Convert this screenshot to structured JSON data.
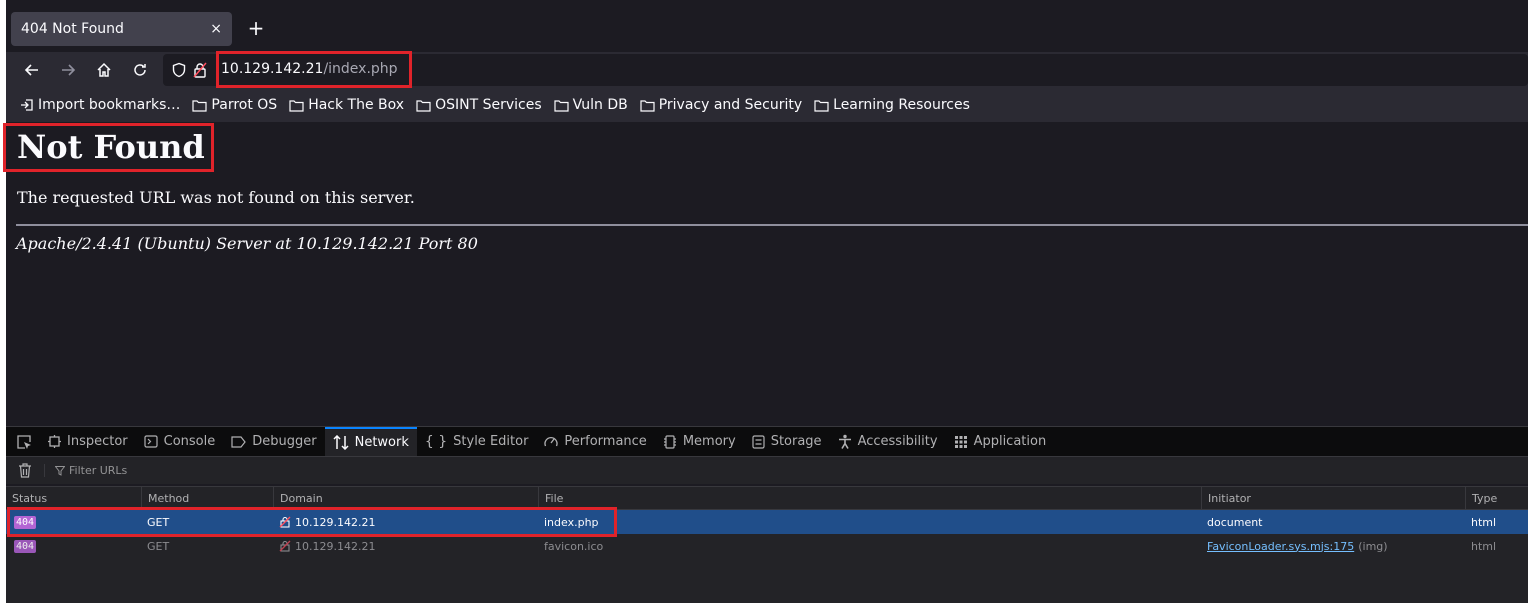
{
  "tab": {
    "title": "404 Not Found",
    "close": "×",
    "new_tab": "+"
  },
  "url": {
    "host": "10.129.142.21",
    "path": "/index.php"
  },
  "bookmarks": [
    {
      "label": "Import bookmarks…",
      "icon": "import-icon"
    },
    {
      "label": "Parrot OS",
      "icon": "folder-icon"
    },
    {
      "label": "Hack The Box",
      "icon": "folder-icon"
    },
    {
      "label": "OSINT Services",
      "icon": "folder-icon"
    },
    {
      "label": "Vuln DB",
      "icon": "folder-icon"
    },
    {
      "label": "Privacy and Security",
      "icon": "folder-icon"
    },
    {
      "label": "Learning Resources",
      "icon": "folder-icon"
    }
  ],
  "page": {
    "title": "Not Found",
    "message": "The requested URL was not found on this server.",
    "address": "Apache/2.4.41 (Ubuntu) Server at 10.129.142.21 Port 80"
  },
  "devtools": {
    "tabs": [
      {
        "label": "Inspector",
        "icon": "inspector-icon"
      },
      {
        "label": "Console",
        "icon": "console-icon"
      },
      {
        "label": "Debugger",
        "icon": "debugger-icon"
      },
      {
        "label": "Network",
        "icon": "network-icon",
        "active": true
      },
      {
        "label": "Style Editor",
        "icon": "style-editor-icon"
      },
      {
        "label": "Performance",
        "icon": "performance-icon"
      },
      {
        "label": "Memory",
        "icon": "memory-icon"
      },
      {
        "label": "Storage",
        "icon": "storage-icon"
      },
      {
        "label": "Accessibility",
        "icon": "accessibility-icon"
      },
      {
        "label": "Application",
        "icon": "application-icon"
      }
    ],
    "filter_placeholder": "Filter URLs",
    "columns": [
      "Status",
      "Method",
      "Domain",
      "File",
      "Initiator",
      "Type"
    ],
    "rows": [
      {
        "status": "404",
        "method": "GET",
        "domain": "10.129.142.21",
        "file": "index.php",
        "initiator": "document",
        "initiator_suffix": "",
        "type": "html"
      },
      {
        "status": "404",
        "method": "GET",
        "domain": "10.129.142.21",
        "file": "favicon.ico",
        "initiator": "FaviconLoader.sys.mjs:175",
        "initiator_suffix": "(img)",
        "type": "html"
      }
    ]
  },
  "colors": {
    "highlight": "#e0232a",
    "selected_row": "#204e8a",
    "status_badge": "#b365d4"
  }
}
